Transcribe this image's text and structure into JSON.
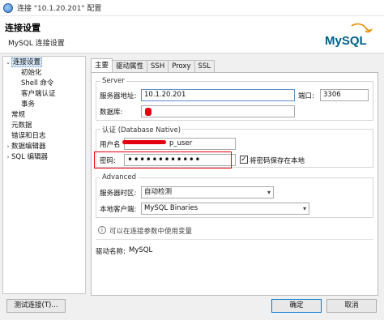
{
  "window": {
    "title": "连接 \"10.1.20.201\" 配置"
  },
  "header": {
    "title": "连接设置",
    "subtitle": "MySQL 连接设置",
    "logo_text": "MySQL"
  },
  "nav": {
    "items": [
      {
        "label": "连接设置",
        "expander": "⌄",
        "selected": true
      },
      {
        "label": "初始化"
      },
      {
        "label": "Shell 命令"
      },
      {
        "label": "客户端认证"
      },
      {
        "label": "事务"
      },
      {
        "label": "常规"
      },
      {
        "label": "元数据"
      },
      {
        "label": "错误和日志"
      },
      {
        "label": "数据编辑器",
        "expander": "›"
      },
      {
        "label": "SQL 编辑器",
        "expander": "›"
      }
    ]
  },
  "tabs": [
    "主要",
    "驱动属性",
    "SSH",
    "Proxy",
    "SSL"
  ],
  "server": {
    "legend": "Server",
    "host_label": "服务器地址:",
    "host_value": "10.1.20.201",
    "port_label": "端口:",
    "port_value": "3306",
    "db_label": "数据库:"
  },
  "auth": {
    "legend": "认证 (Database Native)",
    "user_label": "用户名",
    "user_value": "p_user",
    "password_label": "密码:",
    "password_value": "••••••••••••",
    "save_password_label": "将密码保存在本地",
    "save_password_checked": true
  },
  "advanced": {
    "legend": "Advanced",
    "timezone_label": "服务器时区:",
    "timezone_value": "自动检测",
    "client_label": "本地客户端:",
    "client_value": "MySQL Binaries"
  },
  "hint": "可以在连接参数中使用变量",
  "driver": {
    "label": "驱动名称:",
    "value": "MySQL"
  },
  "buttons": {
    "test": "测试连接(T)...",
    "ok": "确定",
    "cancel": "取消"
  },
  "icons": {
    "dropdown": "▾",
    "check": "✓",
    "info": "i"
  }
}
